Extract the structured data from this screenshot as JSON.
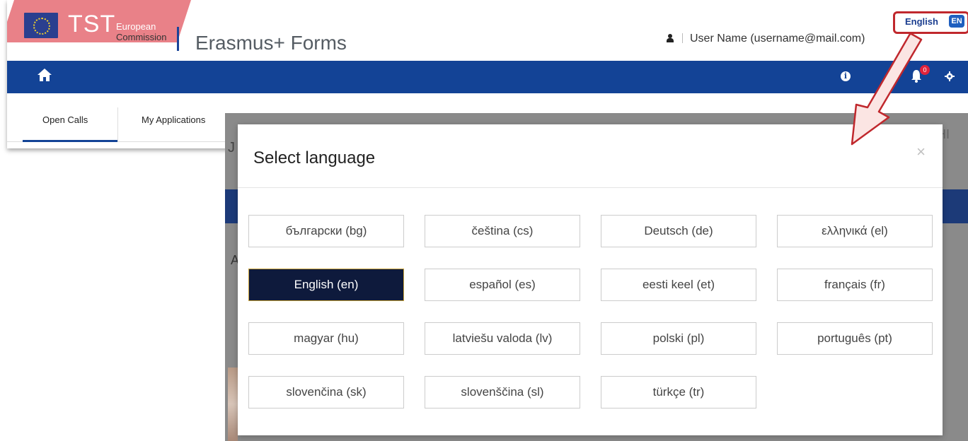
{
  "header": {
    "brand_tst": "TST",
    "brand_line1": "European",
    "brand_line2": "Commission",
    "app_title": "Erasmus+ Forms",
    "user_display": "User Name (username@mail.com)",
    "language_label": "English",
    "language_code": "EN"
  },
  "navbar": {
    "notification_count": "0",
    "icons": [
      "home-icon",
      "info-icon",
      "bell-icon",
      "gear-icon"
    ]
  },
  "tabs": [
    {
      "label": "Open Calls",
      "active": true
    },
    {
      "label": "My Applications",
      "active": false
    }
  ],
  "modal": {
    "title": "Select language",
    "close_glyph": "×",
    "languages": [
      {
        "label": "български (bg)",
        "active": false
      },
      {
        "label": "čeština (cs)",
        "active": false
      },
      {
        "label": "Deutsch (de)",
        "active": false
      },
      {
        "label": "ελληνικά (el)",
        "active": false
      },
      {
        "label": "English (en)",
        "active": true
      },
      {
        "label": "español (es)",
        "active": false
      },
      {
        "label": "eesti keel (et)",
        "active": false
      },
      {
        "label": "français (fr)",
        "active": false
      },
      {
        "label": "magyar (hu)",
        "active": false
      },
      {
        "label": "latviešu valoda (lv)",
        "active": false
      },
      {
        "label": "polski (pl)",
        "active": false
      },
      {
        "label": "português (pt)",
        "active": false
      },
      {
        "label": "slovenčina (sk)",
        "active": false
      },
      {
        "label": "slovenščina (sl)",
        "active": false
      },
      {
        "label": "türkçe (tr)",
        "active": false
      }
    ]
  },
  "background_peek": {
    "right_text": "HI",
    "left_text": "J",
    "mid_text": "A"
  },
  "colors": {
    "primary_blue": "#134396",
    "active_lang_bg": "#0e1a3c",
    "annotation_red": "#c0282d"
  }
}
